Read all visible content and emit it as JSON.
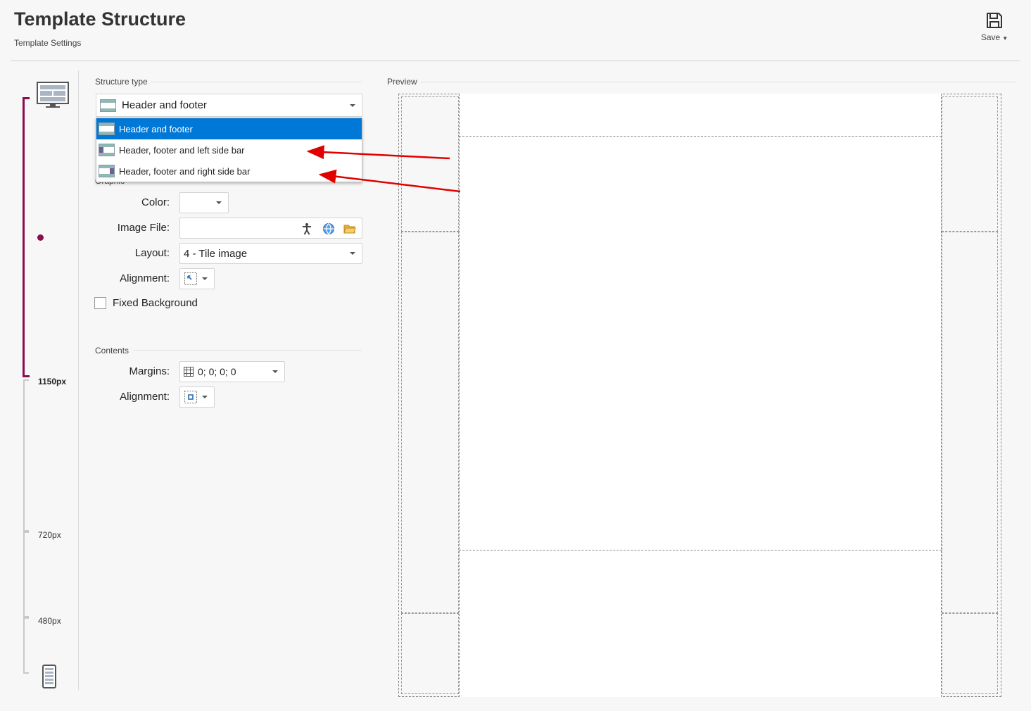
{
  "header": {
    "title": "Template Structure",
    "subtitle": "Template Settings",
    "save_label": "Save"
  },
  "ruler": {
    "breakpoints": [
      "1150px",
      "720px",
      "480px"
    ],
    "active_color": "#8b0d4e"
  },
  "structure": {
    "section_label": "Structure type",
    "selected": "Header and footer",
    "options": [
      "Header and footer",
      "Header, footer and left side bar",
      "Header, footer and right side bar"
    ]
  },
  "graphic": {
    "section_label": "Graphic",
    "color_label": "Color:",
    "color_value": "",
    "image_file_label": "Image File:",
    "image_file_value": "",
    "layout_label": "Layout:",
    "layout_value": "4 - Tile image",
    "alignment_label": "Alignment:",
    "fixed_background_label": "Fixed Background",
    "fixed_background_checked": false
  },
  "contents": {
    "section_label": "Contents",
    "margins_label": "Margins:",
    "margins_value": "0; 0; 0; 0",
    "alignment_label": "Alignment:"
  },
  "preview": {
    "section_label": "Preview"
  },
  "colors": {
    "selection": "#0078d7",
    "annotation_arrow": "#e00000"
  },
  "icons": [
    "save-icon",
    "desktop-icon",
    "mobile-icon",
    "accessibility-icon",
    "globe-icon",
    "folder-icon",
    "alignment-top-left-icon",
    "alignment-center-icon",
    "margins-grid-icon"
  ]
}
